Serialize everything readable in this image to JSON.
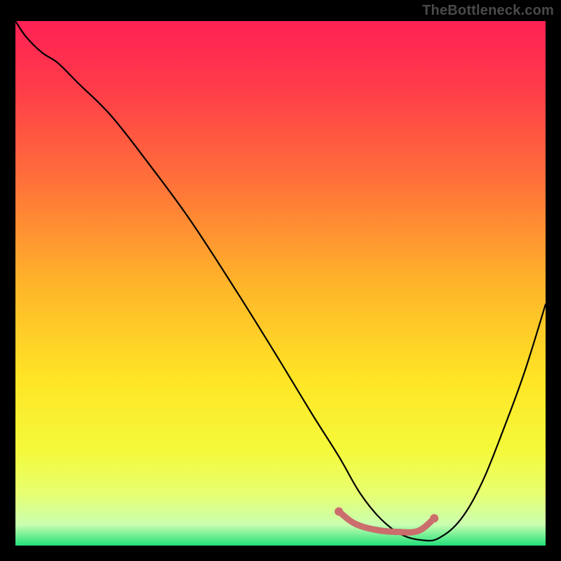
{
  "watermark": "TheBottleneck.com",
  "chart_data": {
    "type": "line",
    "title": "",
    "xlabel": "",
    "ylabel": "",
    "xlim": [
      0,
      100
    ],
    "ylim": [
      0,
      100
    ],
    "grid": false,
    "legend": null,
    "background_gradient": {
      "stops": [
        {
          "offset": 0.0,
          "color": "#ff2155"
        },
        {
          "offset": 0.12,
          "color": "#ff3a4a"
        },
        {
          "offset": 0.3,
          "color": "#ff6f3a"
        },
        {
          "offset": 0.5,
          "color": "#ffb42a"
        },
        {
          "offset": 0.68,
          "color": "#ffe425"
        },
        {
          "offset": 0.82,
          "color": "#f4fa3b"
        },
        {
          "offset": 0.9,
          "color": "#e8ff70"
        },
        {
          "offset": 0.96,
          "color": "#caffb0"
        },
        {
          "offset": 1.0,
          "color": "#22e07a"
        }
      ]
    },
    "series": [
      {
        "name": "bottleneck-curve",
        "color": "#000000",
        "x": [
          0,
          2,
          5,
          8,
          12,
          18,
          25,
          33,
          42,
          50,
          56,
          61,
          65,
          69,
          73,
          77,
          80,
          84,
          88,
          92,
          96,
          100
        ],
        "y": [
          100,
          97,
          94,
          92,
          88,
          82,
          73,
          62,
          48,
          35,
          25,
          17,
          10,
          5,
          2,
          1,
          1.5,
          5,
          12,
          22,
          33,
          46
        ]
      }
    ],
    "highlight": {
      "name": "optimal-range",
      "color": "#cb6d6d",
      "x": [
        61,
        64,
        68,
        72,
        76,
        79
      ],
      "y": [
        6.5,
        4.2,
        3.0,
        2.6,
        2.8,
        5.2
      ],
      "endpoints": [
        {
          "x": 61,
          "y": 6.5
        },
        {
          "x": 79,
          "y": 5.2
        }
      ]
    }
  }
}
